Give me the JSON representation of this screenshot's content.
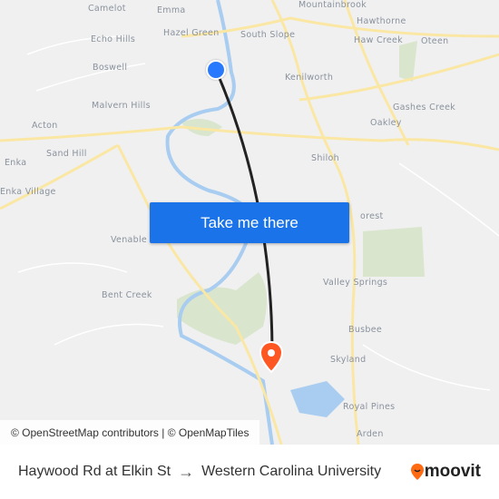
{
  "map": {
    "places": [
      {
        "name": "Camelot"
      },
      {
        "name": "Emma"
      },
      {
        "name": "Mountainbrook"
      },
      {
        "name": "Hawthorne"
      },
      {
        "name": "Hazel Green"
      },
      {
        "name": "South Slope"
      },
      {
        "name": "Echo Hills"
      },
      {
        "name": "Haw Creek"
      },
      {
        "name": "Oteen"
      },
      {
        "name": "Boswell"
      },
      {
        "name": "Kenilworth"
      },
      {
        "name": "Malvern Hills"
      },
      {
        "name": "Gashes Creek"
      },
      {
        "name": "Acton"
      },
      {
        "name": "Oakley"
      },
      {
        "name": "Sand Hill"
      },
      {
        "name": "Shiloh"
      },
      {
        "name": "Enka"
      },
      {
        "name": "Enka Village"
      },
      {
        "name": "Venable"
      },
      {
        "name": "orest"
      },
      {
        "name": "Bent Creek"
      },
      {
        "name": "Valley Springs"
      },
      {
        "name": "Busbee"
      },
      {
        "name": "Skyland"
      },
      {
        "name": "Royal Pines"
      },
      {
        "name": "Arden"
      }
    ],
    "origin_color": "#2979ff",
    "destination_color": "#ff5722",
    "route_color": "#222222"
  },
  "cta": {
    "label": "Take me there"
  },
  "attribution": "© OpenStreetMap contributors | © OpenMapTiles",
  "footer": {
    "from": "Haywood Rd at Elkin St",
    "arrow": "→",
    "to": "Western Carolina University",
    "brand": "moovit",
    "brand_color": "#ff6a13"
  }
}
